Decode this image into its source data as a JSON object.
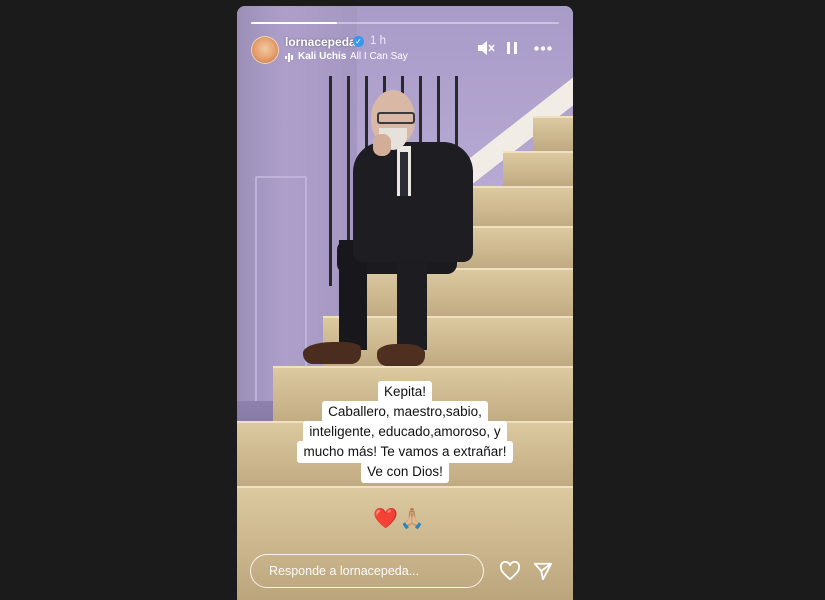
{
  "story": {
    "progress_percent": 28,
    "username": "lornacepeda",
    "verified_mark": "✓",
    "time": "1 h",
    "music": {
      "icon": "audio-bars-icon",
      "artist": "Kali Uchis",
      "separator": "·",
      "song": "All I Can Say"
    },
    "caption_lines": [
      "Kepita!",
      "Caballero, maestro,sabio,",
      "inteligente, educado,amoroso, y",
      "mucho más! Te vamos a extrañar!",
      "Ve con Dios!"
    ],
    "emoji": "❤️🙏🏼",
    "reply_placeholder": "Responde a lornacepeda..."
  },
  "icons": {
    "mute": "muted-speaker-icon",
    "pause": "pause-icon",
    "more": "more-dots-icon",
    "like": "heart-icon",
    "share": "send-icon"
  },
  "colors": {
    "background": "#1b1b1b",
    "verified": "#3897f0"
  }
}
